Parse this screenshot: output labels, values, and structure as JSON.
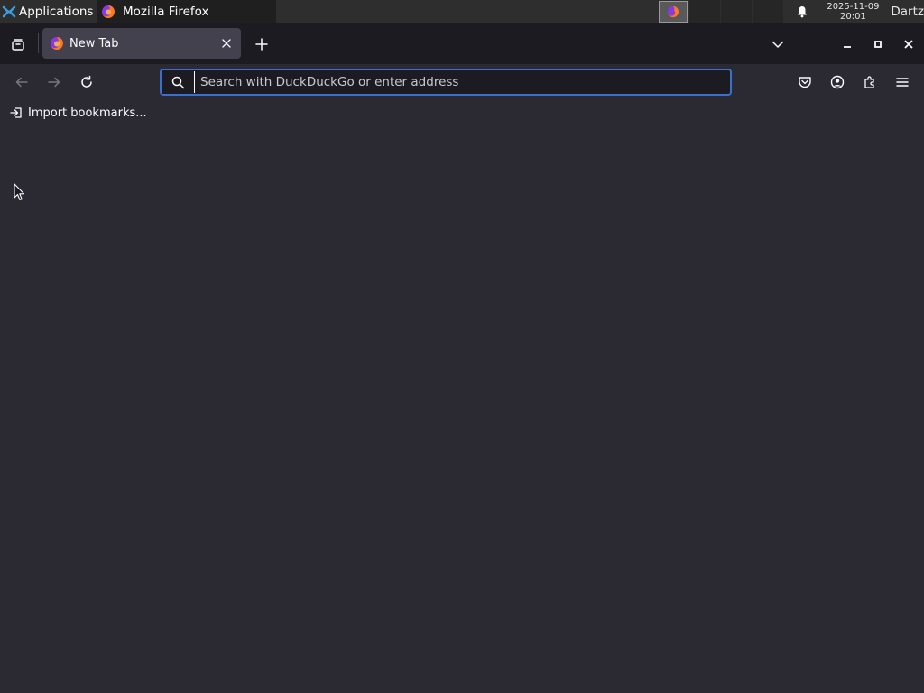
{
  "panel": {
    "apps_label": "Applications",
    "apps_separator": "☰",
    "task_label": "Mozilla Firefox",
    "clock_date": "2025-11-09",
    "clock_time": "20:01",
    "user_label": "Dartz"
  },
  "browser": {
    "tab_title": "New Tab",
    "url_placeholder": "Search with DuckDuckGo or enter address",
    "url_value": "",
    "bookmark_import_label": "Import bookmarks..."
  },
  "icons": {
    "apps": "xfce-logo-icon",
    "firefox": "firefox-icon",
    "bell": "bell-icon",
    "tab_manager": "tab-manager-icon",
    "new_tab": "plus-icon",
    "list_tabs": "chevron-down-icon",
    "back": "back-arrow-icon",
    "forward": "forward-arrow-icon",
    "reload": "reload-icon",
    "search": "search-icon",
    "pocket": "pocket-icon",
    "account": "account-icon",
    "extensions": "extensions-icon",
    "menu": "hamburger-menu-icon",
    "import": "import-icon"
  },
  "colors": {
    "accent_focus": "#3a6ecf",
    "toolbar_bg": "#2b2a33",
    "tabstrip_bg": "#1c1b22",
    "selected_tab_bg": "#42414d"
  }
}
